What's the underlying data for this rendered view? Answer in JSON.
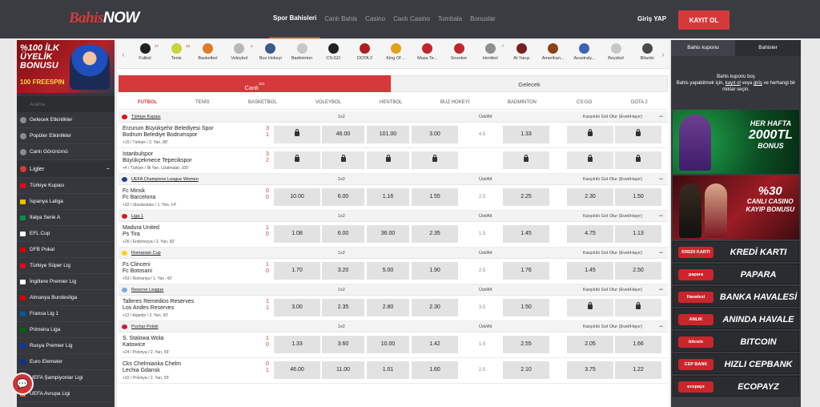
{
  "header": {
    "logo_main": "Bahis",
    "logo_accent": "NOW",
    "nav": [
      {
        "label": "Spor Bahisleri"
      },
      {
        "label": "Canlı Bahis"
      },
      {
        "label": "Casino"
      },
      {
        "label": "Canlı Casino"
      },
      {
        "label": "Tombala"
      },
      {
        "label": "Bonuslar"
      }
    ],
    "login": "Giriş YAP",
    "signup": "KAYIT OL"
  },
  "sidebar": {
    "promo_line1": "%100 İLK ÜYELİK BONUSU",
    "promo_line2": "100 FREESPIN",
    "search_placeholder": "Arama",
    "links": [
      {
        "label": "Gelecek Etkinlikler"
      },
      {
        "label": "Popüler Etkinlikler"
      },
      {
        "label": "Canlı Görünümü"
      }
    ],
    "leagues_title": "Ligler",
    "leagues_toggle": "−",
    "leagues": [
      {
        "label": "Türkiye Kupası",
        "color": "#e30a17"
      },
      {
        "label": "İspanya Laliga",
        "color": "#f1bf00"
      },
      {
        "label": "İtalya Serie A",
        "color": "#009246"
      },
      {
        "label": "EFL Cup",
        "color": "#ffffff"
      },
      {
        "label": "DFB Pokal",
        "color": "#dd0000"
      },
      {
        "label": "Türkiye Süper Lig",
        "color": "#e30a17"
      },
      {
        "label": "İngiltere Premier Lig",
        "color": "#ffffff"
      },
      {
        "label": "Almanya Bundesliga",
        "color": "#dd0000"
      },
      {
        "label": "Fransa Lig 1",
        "color": "#0055a4"
      },
      {
        "label": "Primeira Liga",
        "color": "#006600"
      },
      {
        "label": "Rusya Premier Lig",
        "color": "#0039a6"
      },
      {
        "label": "Euro Elemeler",
        "color": "#003399"
      },
      {
        "label": "UEFA Şampiyonlar Ligi",
        "color": "#1a3d8f"
      },
      {
        "label": "UEFA Avrupa Ligi",
        "color": "#f26522"
      }
    ],
    "chat_icon": "chat-icon"
  },
  "sports": [
    {
      "label": "Futbol",
      "count": "37",
      "color": "#222222"
    },
    {
      "label": "Tenis",
      "count": "25",
      "color": "#c5d639"
    },
    {
      "label": "Basketbol",
      "count": "",
      "color": "#e07a28"
    },
    {
      "label": "Voleybol",
      "count": "4",
      "color": "#b8b8b8"
    },
    {
      "label": "Buz Hokeyi",
      "count": "",
      "color": "#3b5b8c"
    },
    {
      "label": "Badminton",
      "count": "",
      "color": "#c8c8c8"
    },
    {
      "label": "CS:GO",
      "count": "",
      "color": "#222222"
    },
    {
      "label": "DOTA 2",
      "count": "",
      "color": "#b01f1f"
    },
    {
      "label": "King Of ...",
      "count": "",
      "color": "#e0a21c"
    },
    {
      "label": "Masa Te...",
      "count": "",
      "color": "#c0272d"
    },
    {
      "label": "Snooker",
      "count": "",
      "color": "#c0272d"
    },
    {
      "label": "Hentbol",
      "count": "7",
      "color": "#8f8f8f"
    },
    {
      "label": "At Yarışı",
      "count": "",
      "color": "#7a1f1f"
    },
    {
      "label": "Amerikan...",
      "count": "",
      "color": "#8b4513"
    },
    {
      "label": "Avustraly...",
      "count": "",
      "color": "#3a63b5"
    },
    {
      "label": "Beyzbol",
      "count": "",
      "color": "#c8c8c8"
    },
    {
      "label": "Bilardo",
      "count": "",
      "color": "#4a4a4a"
    }
  ],
  "tabs": {
    "live": "Canlı",
    "live_count": "101",
    "upcoming": "Gelecek"
  },
  "sport_tabs": [
    "FUTBOL",
    "TENİS",
    "BASKETBOL",
    "VOLEYBOL",
    "HENTBOL",
    "BUZ HOKEYİ",
    "BADMINTON",
    "CS:GO",
    "DOTA 2"
  ],
  "market_headers": {
    "m1": "1x2",
    "m2": "Üst/Alt",
    "m3": "Karşılıklı Gol Olur (Evet/Hayır)"
  },
  "leagues": [
    {
      "name": "Türkiye Kupası",
      "flag": "#e30a17",
      "events": [
        {
          "home": "Erzurum Büyükşehir Belediyesi Spor",
          "away": "Bodrum Belediye Bodrumspor",
          "hs": "3",
          "as": "1",
          "meta": "+15 / Türkiye / 2. Yarı, 88'",
          "o1": "",
          "ox": "46.00",
          "o2": "101.00",
          "ou": "3.00",
          "line": "4.5",
          "ua": "1.33",
          "ky": "",
          "kn": "",
          "locks": [
            true,
            false,
            false,
            false,
            false,
            true,
            true
          ]
        },
        {
          "home": "Istanbulspor",
          "away": "Büyükçekmece Tepecikspor",
          "hs": "3",
          "as": "2",
          "meta": "+4 / Türkiye / İlk Yarı, Uzatmalar, 105'",
          "o1": "",
          "ox": "",
          "o2": "",
          "ou": "",
          "line": "",
          "ua": "",
          "ky": "",
          "kn": "",
          "locks": [
            true,
            true,
            true,
            true,
            true,
            true,
            true
          ]
        }
      ]
    },
    {
      "name": "UEFA Champions League Women",
      "flag": "#1a3d8f",
      "events": [
        {
          "home": "Fc Minsk",
          "away": "Fc Barcelona",
          "hs": "0",
          "as": "0",
          "meta": "+32 / Uluslararası / 1. Yarı, 14'",
          "o1": "10.00",
          "ox": "6.00",
          "o2": "1.16",
          "ou": "1.55",
          "line": "2.5",
          "ua": "2.25",
          "ky": "2.30",
          "kn": "1.50",
          "locks": [
            false,
            false,
            false,
            false,
            false,
            false,
            false
          ]
        }
      ]
    },
    {
      "name": "Liga 1",
      "flag": "#d01c1f",
      "events": [
        {
          "home": "Madura United",
          "away": "Ps Tira",
          "hs": "1",
          "as": "0",
          "meta": "+26 / Endonezya / 2. Yarı, 82'",
          "o1": "1.08",
          "ox": "6.00",
          "o2": "36.00",
          "ou": "2.35",
          "line": "1.5",
          "ua": "1.45",
          "ky": "4.75",
          "kn": "1.13",
          "locks": [
            false,
            false,
            false,
            false,
            false,
            false,
            false
          ]
        }
      ]
    },
    {
      "name": "Romanian Cup",
      "flag": "#fcd116",
      "events": [
        {
          "home": "Fs Clinceni",
          "away": "Fc Botosani",
          "hs": "1",
          "as": "0",
          "meta": "+53 / Romanya / 1. Yarı, 43'",
          "o1": "1.70",
          "ox": "3.20",
          "o2": "5.00",
          "ou": "1.90",
          "line": "2.5",
          "ua": "1.76",
          "ky": "1.45",
          "kn": "2.50",
          "locks": [
            false,
            false,
            false,
            false,
            false,
            false,
            false
          ]
        }
      ]
    },
    {
      "name": "Reserve League",
      "flag": "#74acdf",
      "events": [
        {
          "home": "Talleres Remedios Reserves",
          "away": "Los Andes Reserves",
          "hs": "1",
          "as": "1",
          "meta": "+12 / Arjantin / 2. Yarı, 50'",
          "o1": "3.00",
          "ox": "2.35",
          "o2": "2.80",
          "ou": "2.30",
          "line": "3.5",
          "ua": "1.50",
          "ky": "",
          "kn": "",
          "locks": [
            false,
            false,
            false,
            false,
            false,
            true,
            true
          ]
        }
      ]
    },
    {
      "name": "Puchar Polski",
      "flag": "#dc143c",
      "events": [
        {
          "home": "S. Stalowa Wola",
          "away": "Katowice",
          "hs": "1",
          "as": "0",
          "meta": "+24 / Polonya / 2. Yarı, 56'",
          "o1": "1.33",
          "ox": "3.60",
          "o2": "10.00",
          "ou": "1.42",
          "line": "1.5",
          "ua": "2.55",
          "ky": "2.05",
          "kn": "1.66",
          "locks": [
            false,
            false,
            false,
            false,
            false,
            false,
            false
          ]
        },
        {
          "home": "Cks Chelmianka Chelm",
          "away": "Lechia Gdansk",
          "hs": "0",
          "as": "1",
          "meta": "+32 / Polonya / 2. Yarı, 55'",
          "o1": "46.00",
          "ox": "11.00",
          "o2": "1.01",
          "ou": "1.60",
          "line": "2.5",
          "ua": "2.10",
          "ky": "3.75",
          "kn": "1.22",
          "locks": [
            false,
            false,
            false,
            false,
            false,
            false,
            false
          ]
        }
      ]
    }
  ],
  "right": {
    "tab_coupon": "Bahis kuponu",
    "tab_bets": "Bahisler",
    "empty_title": "Bahis kuponu boş",
    "empty_pre": "Bahis yapabilmek için,",
    "empty_login": "kayıt ol",
    "empty_or": "veya",
    "empty_signin": "giriş",
    "empty_post": "ve herhangi bir miktar seçin.",
    "banner1_top": "HER HAFTA",
    "banner1_big": "2000TL",
    "banner1_bottom": "BONUS",
    "banner2_top": "%30",
    "banner2_mid": "CANLI CASINO",
    "banner2_bottom": "KAYIP BONUSU",
    "payments": [
      {
        "logo": "KREDI KARTI",
        "name": "KREDİ KARTI"
      },
      {
        "logo": "papara",
        "name": "PAPARA"
      },
      {
        "logo": "Havalesi",
        "name": "BANKA HAVALESİ"
      },
      {
        "logo": "ANLIK",
        "name": "ANINDA HAVALE"
      },
      {
        "logo": "bitcoin",
        "name": "BITCOIN"
      },
      {
        "logo": "CEP BANK",
        "name": "HIZLI CEPBANK"
      },
      {
        "logo": "ecopayz",
        "name": "ECOPAYZ"
      }
    ]
  }
}
